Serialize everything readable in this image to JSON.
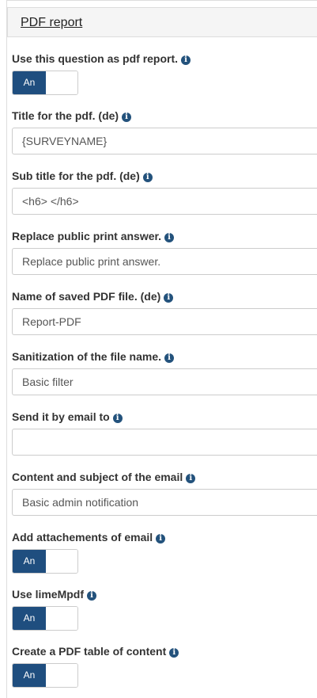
{
  "panel": {
    "title": "PDF report"
  },
  "fields": {
    "use_question": {
      "label": "Use this question as pdf report.",
      "toggle": "An"
    },
    "title_pdf": {
      "label": "Title for the pdf. (de)",
      "value": "{SURVEYNAME}"
    },
    "subtitle_pdf": {
      "label": "Sub title for the pdf. (de)",
      "value": "<h6> </h6>"
    },
    "replace_print": {
      "label": "Replace public print answer.",
      "value": "Replace public print answer."
    },
    "saved_name": {
      "label": "Name of saved PDF file. (de)",
      "value": "Report-PDF"
    },
    "sanitization": {
      "label": "Sanitization of the file name.",
      "value": "Basic filter"
    },
    "send_email": {
      "label": "Send it by email to",
      "value": ""
    },
    "email_content": {
      "label": "Content and subject of the email",
      "value": "Basic admin notification"
    },
    "attachments": {
      "label": "Add attachements of email",
      "toggle": "An"
    },
    "limempdf": {
      "label": "Use limeMpdf",
      "toggle": "An"
    },
    "toc": {
      "label": "Create a PDF table of content",
      "toggle": "An"
    }
  },
  "icons": {
    "info": "info-circle-icon"
  },
  "colors": {
    "toggle_on": "#1f4e7f",
    "info_icon": "#23527c"
  }
}
